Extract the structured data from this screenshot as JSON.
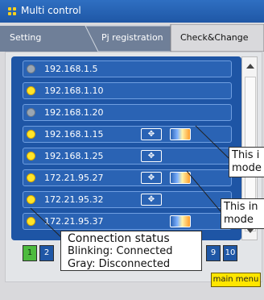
{
  "window": {
    "title": "Multi control"
  },
  "tabs": [
    {
      "label": "Setting",
      "active": false
    },
    {
      "label": "Pj registration",
      "active": false
    },
    {
      "label": "Check&Change",
      "active": true
    }
  ],
  "rows": [
    {
      "ip": "192.168.1.5",
      "connected": false,
      "move": "",
      "mode": false
    },
    {
      "ip": "192.168.1.10",
      "connected": true,
      "move": "",
      "mode": false
    },
    {
      "ip": "192.168.1.20",
      "connected": false,
      "move": "",
      "mode": false
    },
    {
      "ip": "192.168.1.15",
      "connected": true,
      "move": "✥",
      "mode": true
    },
    {
      "ip": "192.168.1.25",
      "connected": true,
      "move": "✥",
      "mode": false
    },
    {
      "ip": "172.21.95.27",
      "connected": true,
      "move": "✥",
      "mode": true
    },
    {
      "ip": "172.21.95.32",
      "connected": true,
      "move": "✥",
      "mode": false
    },
    {
      "ip": "172.21.95.37",
      "connected": true,
      "move": "",
      "mode": true
    }
  ],
  "pager": {
    "pages": [
      "1",
      "2",
      "9",
      "10"
    ],
    "selected": "1"
  },
  "main_menu_button": "main menu",
  "callouts": {
    "mode1": {
      "line1": "This i",
      "line2": "mode"
    },
    "mode2": {
      "line1": "This in",
      "line2": "mode"
    },
    "status": {
      "heading": "Connection status",
      "line1": "Blinking: Connected",
      "line2": "Gray: Disconnected"
    }
  },
  "colors": {
    "title_bar": "#2f6fc2",
    "list_bg": "#1e55a5",
    "connected_dot": "#ffe52a",
    "disconnected_dot": "#9aa6b3",
    "main_menu_bg": "#ffe600"
  }
}
